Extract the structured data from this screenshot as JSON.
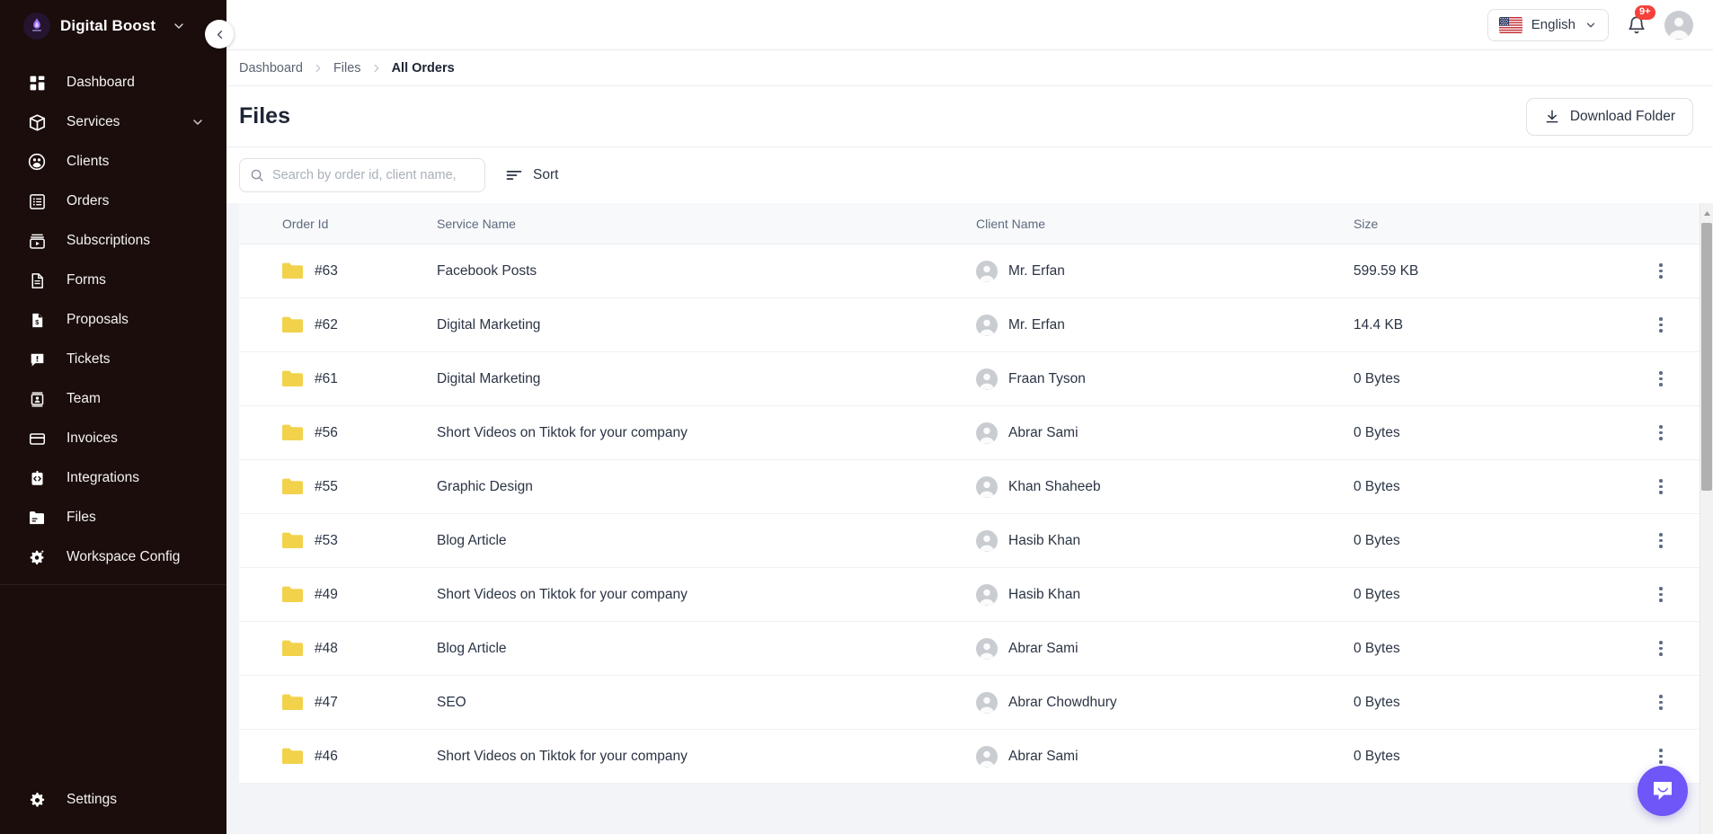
{
  "brand": {
    "name": "Digital Boost",
    "logo_icon": "flame-logo-icon",
    "caret_icon": "chevron-down-icon"
  },
  "sidebar": {
    "collapse_icon": "chevron-left-icon",
    "items": [
      {
        "label": "Dashboard",
        "icon": "dashboard-grid-icon"
      },
      {
        "label": "Services",
        "icon": "package-box-icon",
        "caret": "chevron-down-icon"
      },
      {
        "label": "Clients",
        "icon": "users-circle-icon"
      },
      {
        "label": "Orders",
        "icon": "list-rows-icon"
      },
      {
        "label": "Subscriptions",
        "icon": "video-play-icon"
      },
      {
        "label": "Forms",
        "icon": "document-lines-icon"
      },
      {
        "label": "Proposals",
        "icon": "document-dollar-icon"
      },
      {
        "label": "Tickets",
        "icon": "chat-alert-icon"
      },
      {
        "label": "Team",
        "icon": "id-badge-icon"
      },
      {
        "label": "Invoices",
        "icon": "credit-card-icon"
      },
      {
        "label": "Integrations",
        "icon": "code-clipboard-icon"
      },
      {
        "label": "Files",
        "icon": "folder-icon"
      },
      {
        "label": "Workspace Config",
        "icon": "gear-sparkle-icon"
      }
    ],
    "bottom_item": {
      "label": "Settings",
      "icon": "gear-icon"
    }
  },
  "topbar": {
    "language": {
      "label": "English",
      "flag_icon": "us-flag-icon",
      "caret_icon": "chevron-down-icon"
    },
    "notifications": {
      "icon": "bell-icon",
      "badge": "9+"
    },
    "avatar_icon": "user-avatar-icon"
  },
  "breadcrumb": {
    "items": [
      "Dashboard",
      "Files",
      "All Orders"
    ],
    "separator_icon": "chevron-right-icon"
  },
  "page": {
    "title": "Files",
    "download_button": {
      "label": "Download Folder",
      "icon": "download-icon"
    }
  },
  "toolbar": {
    "search": {
      "placeholder": "Search by order id, client name,",
      "value": "",
      "icon": "search-icon"
    },
    "sort": {
      "label": "Sort",
      "icon": "sort-lines-icon"
    }
  },
  "table": {
    "columns": [
      "Order Id",
      "Service Name",
      "Client Name",
      "Size"
    ],
    "row_menu_icon": "kebab-menu-icon",
    "folder_icon": "folder-icon",
    "folder_color": "#F2D24B",
    "client_avatar_icon": "user-avatar-icon",
    "rows": [
      {
        "order_id": "#63",
        "service": "Facebook Posts",
        "client": "Mr. Erfan",
        "size": "599.59 KB"
      },
      {
        "order_id": "#62",
        "service": "Digital Marketing",
        "client": "Mr. Erfan",
        "size": "14.4 KB"
      },
      {
        "order_id": "#61",
        "service": "Digital Marketing",
        "client": "Fraan Tyson",
        "size": "0 Bytes"
      },
      {
        "order_id": "#56",
        "service": "Short Videos on Tiktok for your company",
        "client": "Abrar Sami",
        "size": "0 Bytes"
      },
      {
        "order_id": "#55",
        "service": "Graphic Design",
        "client": "Khan Shaheeb",
        "size": "0 Bytes"
      },
      {
        "order_id": "#53",
        "service": "Blog Article",
        "client": "Hasib Khan",
        "size": "0 Bytes"
      },
      {
        "order_id": "#49",
        "service": "Short Videos on Tiktok for your company",
        "client": "Hasib Khan",
        "size": "0 Bytes"
      },
      {
        "order_id": "#48",
        "service": "Blog Article",
        "client": "Abrar Sami",
        "size": "0 Bytes"
      },
      {
        "order_id": "#47",
        "service": "SEO",
        "client": "Abrar Chowdhury",
        "size": "0 Bytes"
      },
      {
        "order_id": "#46",
        "service": "Short Videos on Tiktok for your company",
        "client": "Abrar Sami",
        "size": "0 Bytes"
      }
    ]
  },
  "chat_widget": {
    "icon": "chat-bubble-icon",
    "color": "#6E56F8"
  },
  "colors": {
    "sidebar_bg": "#1A0D0C",
    "accent": "#6E56F8",
    "badge_red": "#F4413B",
    "folder_yellow": "#F2D24B"
  }
}
